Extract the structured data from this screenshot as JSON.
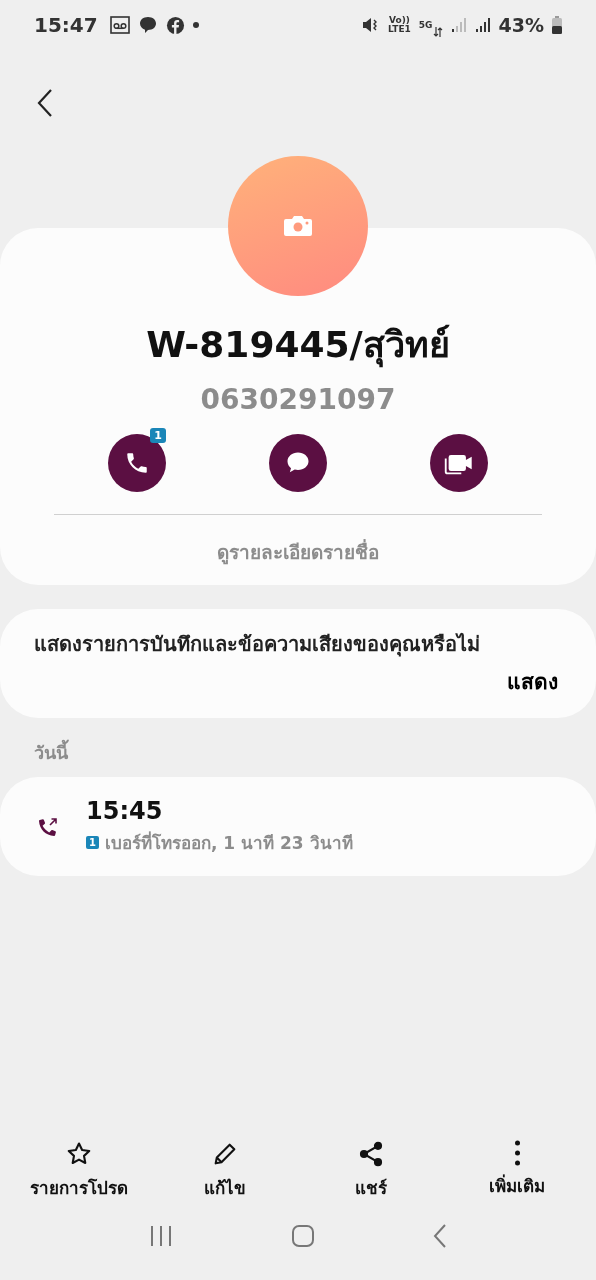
{
  "status_bar": {
    "time": "15:47",
    "volte": "Vo))",
    "lte": "LTE1",
    "network": "5G",
    "battery": "43%"
  },
  "contact": {
    "name": "W-819445/สุวิทย์",
    "number": "0630291097",
    "actions": [
      {
        "kind": "call",
        "badge": "1"
      },
      {
        "kind": "message"
      },
      {
        "kind": "video"
      }
    ],
    "details_link": "ดูรายละเอียดรายชื่อ"
  },
  "prompt": {
    "text": "แสดงรายการบันทึกและข้อความเสียงของคุณหรือไม่",
    "action": "แสดง"
  },
  "log": {
    "section": "วันนี้",
    "entries": [
      {
        "kind": "outgoing",
        "time": "15:45",
        "sim": "1",
        "description": "เบอร์ที่โทรออก, 1 นาที 23 วินาที"
      }
    ]
  },
  "bottom_actions": [
    {
      "kind": "favorite",
      "label": "รายการโปรด"
    },
    {
      "kind": "edit",
      "label": "แก้ไข"
    },
    {
      "kind": "share",
      "label": "แชร์"
    },
    {
      "kind": "more",
      "label": "เพิ่มเติม"
    }
  ]
}
